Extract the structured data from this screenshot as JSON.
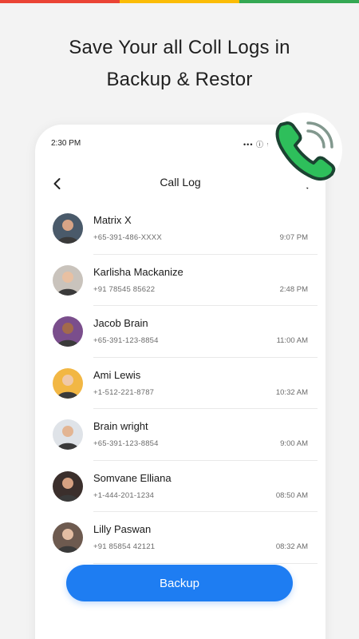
{
  "colors": {
    "top_bar": [
      "#ea4335",
      "#fbbc05",
      "#34a853"
    ],
    "accent": "#1e7df2",
    "call_green": "#2ebf5b",
    "call_outline": "#1b4332"
  },
  "headline": {
    "line1": "Save Your all Coll Logs in",
    "line2": "Backup & Restor"
  },
  "status_bar": {
    "time": "2:30 PM",
    "icons": "••• ⓘ ıll"
  },
  "nav": {
    "title": "Call Log",
    "back_icon": "chevron-left-icon",
    "search_icon": "search-icon"
  },
  "call_log": [
    {
      "name": "Matrix X",
      "number": "+65-391-486-XXXX",
      "time": "9:07 PM",
      "avatar_bg": "#4a5a6a",
      "avatar_skin": "#d8a486"
    },
    {
      "name": "Karlisha Mackanize",
      "number": "+91 78545 85622",
      "time": "2:48 PM",
      "avatar_bg": "#c9c3bc",
      "avatar_skin": "#e8c0a2"
    },
    {
      "name": "Jacob Brain",
      "number": "+65-391-123-8854",
      "time": "11:00 AM",
      "avatar_bg": "#7a4e8c",
      "avatar_skin": "#a36a4c"
    },
    {
      "name": "Ami Lewis",
      "number": "+1-512-221-8787",
      "time": "10:32 AM",
      "avatar_bg": "#f2b744",
      "avatar_skin": "#f0c9a8"
    },
    {
      "name": "Brain wright",
      "number": "+65-391-123-8854",
      "time": "9:00 AM",
      "avatar_bg": "#dfe3e8",
      "avatar_skin": "#e3b593"
    },
    {
      "name": "Somvane Elliana",
      "number": "+1-444-201-1234",
      "time": "08:50 AM",
      "avatar_bg": "#3b2f2c",
      "avatar_skin": "#d6a182"
    },
    {
      "name": "Lilly Paswan",
      "number": "+91 85854 42121",
      "time": "08:32 AM",
      "avatar_bg": "#6d5a4f",
      "avatar_skin": "#e4bea3"
    }
  ],
  "backup_button": {
    "label": "Backup"
  },
  "badge_icon": "phone-call-icon"
}
